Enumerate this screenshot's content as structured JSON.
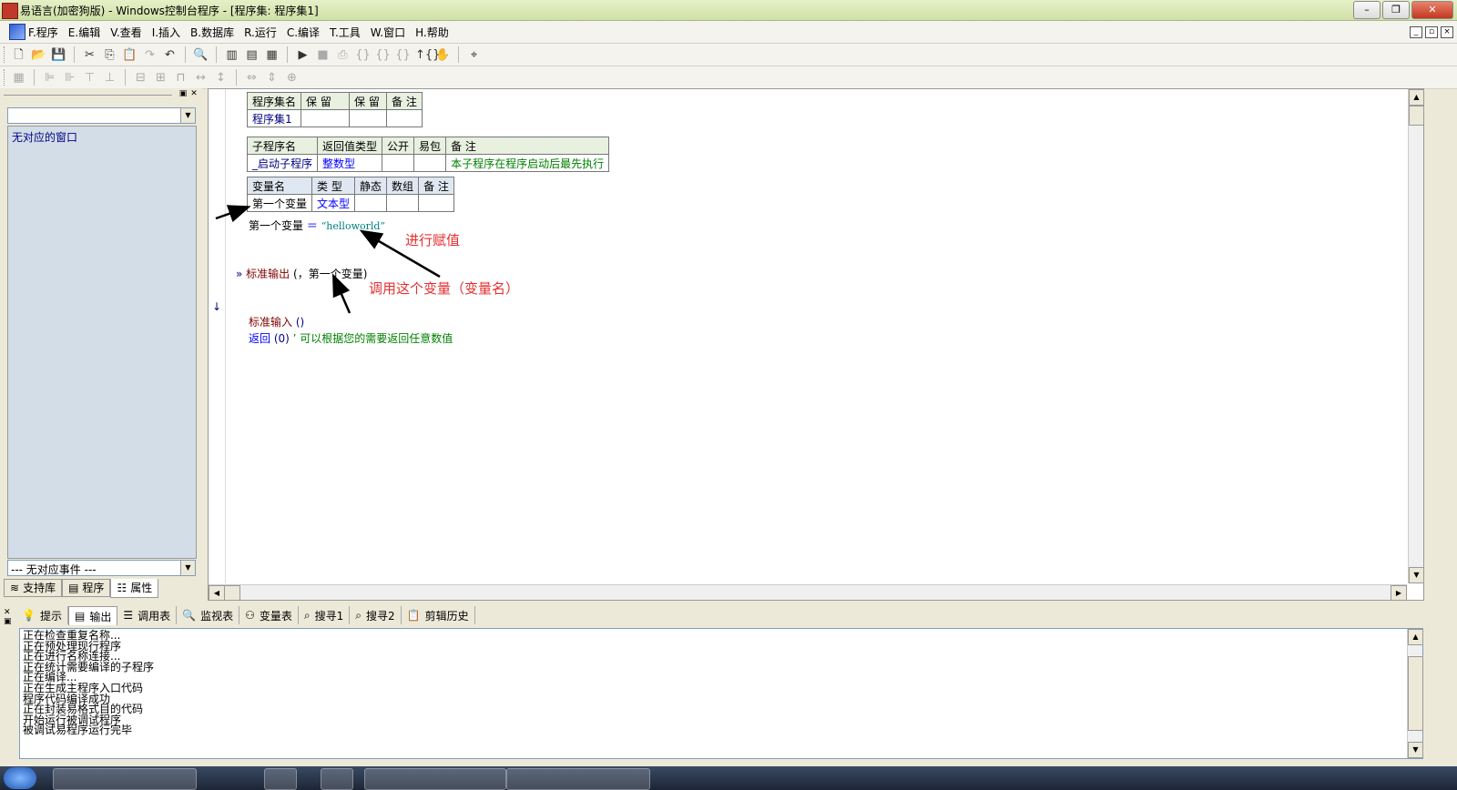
{
  "window": {
    "title": "易语言(加密狗版) - Windows控制台程序 - [程序集: 程序集1]"
  },
  "window_buttons": [
    "–",
    "❐",
    "✕"
  ],
  "menu": [
    "F.程序",
    "E.编辑",
    "V.查看",
    "I.插入",
    "B.数据库",
    "R.运行",
    "C.编译",
    "T.工具",
    "W.窗口",
    "H.帮助"
  ],
  "left_panel": {
    "top_combo_value": "",
    "list_item": "无对应的窗口",
    "bottom_combo_value": "--- 无对应事件 ---",
    "tabs": [
      "支持库",
      "程序",
      "属性"
    ]
  },
  "editor": {
    "assembly_table": {
      "headers": [
        "程序集名",
        "保 留",
        "保 留",
        "备 注"
      ],
      "row": [
        "程序集1",
        "",
        "",
        ""
      ]
    },
    "sub_table": {
      "headers": [
        "子程序名",
        "返回值类型",
        "公开",
        "易包",
        "备 注"
      ],
      "row": [
        "_启动子程序",
        "整数型",
        "",
        "",
        "本子程序在程序启动后最先执行"
      ]
    },
    "var_table": {
      "headers": [
        "变量名",
        "类 型",
        "静态",
        "数组",
        "备 注"
      ],
      "row": [
        "第一个变量",
        "文本型",
        "",
        "",
        ""
      ]
    },
    "code": {
      "line1_var": "第一个变量",
      "line1_op": "＝",
      "line1_str": "“helloworld”",
      "line2_marker": "»",
      "line2_func": "标准输出",
      "line2_args": "(，第一个变量)",
      "line3_func": "标准输入",
      "line3_args": "()",
      "line4_kw": "返回",
      "line4_args": "(0)",
      "line4_comment": "’ 可以根据您的需要返回任意数值"
    },
    "annotations": {
      "assign": "进行赋值",
      "call": "调用这个变量（变量名）"
    }
  },
  "bottom_panel": {
    "tabs": [
      "提示",
      "输出",
      "调用表",
      "监视表",
      "变量表",
      "搜寻1",
      "搜寻2",
      "剪辑历史"
    ],
    "output_lines": [
      "正在检查重复名称...",
      "正在预处理现行程序",
      "正在进行名称连接...",
      "正在统计需要编译的子程序",
      "正在编译...",
      "正在生成主程序入口代码",
      "程序代码编译成功",
      "正在封装易格式目的代码",
      "开始运行被调试程序",
      "被调试易程序运行完毕"
    ]
  },
  "icons": {
    "accent": "#e53030",
    "toolbar1": [
      "new-file-icon",
      "open-icon",
      "save-icon",
      "cut-icon",
      "copy-icon",
      "paste-icon",
      "redo-icon",
      "undo-icon",
      "find-icon",
      "layout1-icon",
      "layout2-icon",
      "layout3-icon",
      "run-icon",
      "stop-icon",
      "step-icon",
      "step-into-icon",
      "step-out-icon",
      "step-over-icon",
      "hand-icon",
      "binoculars-icon"
    ]
  }
}
